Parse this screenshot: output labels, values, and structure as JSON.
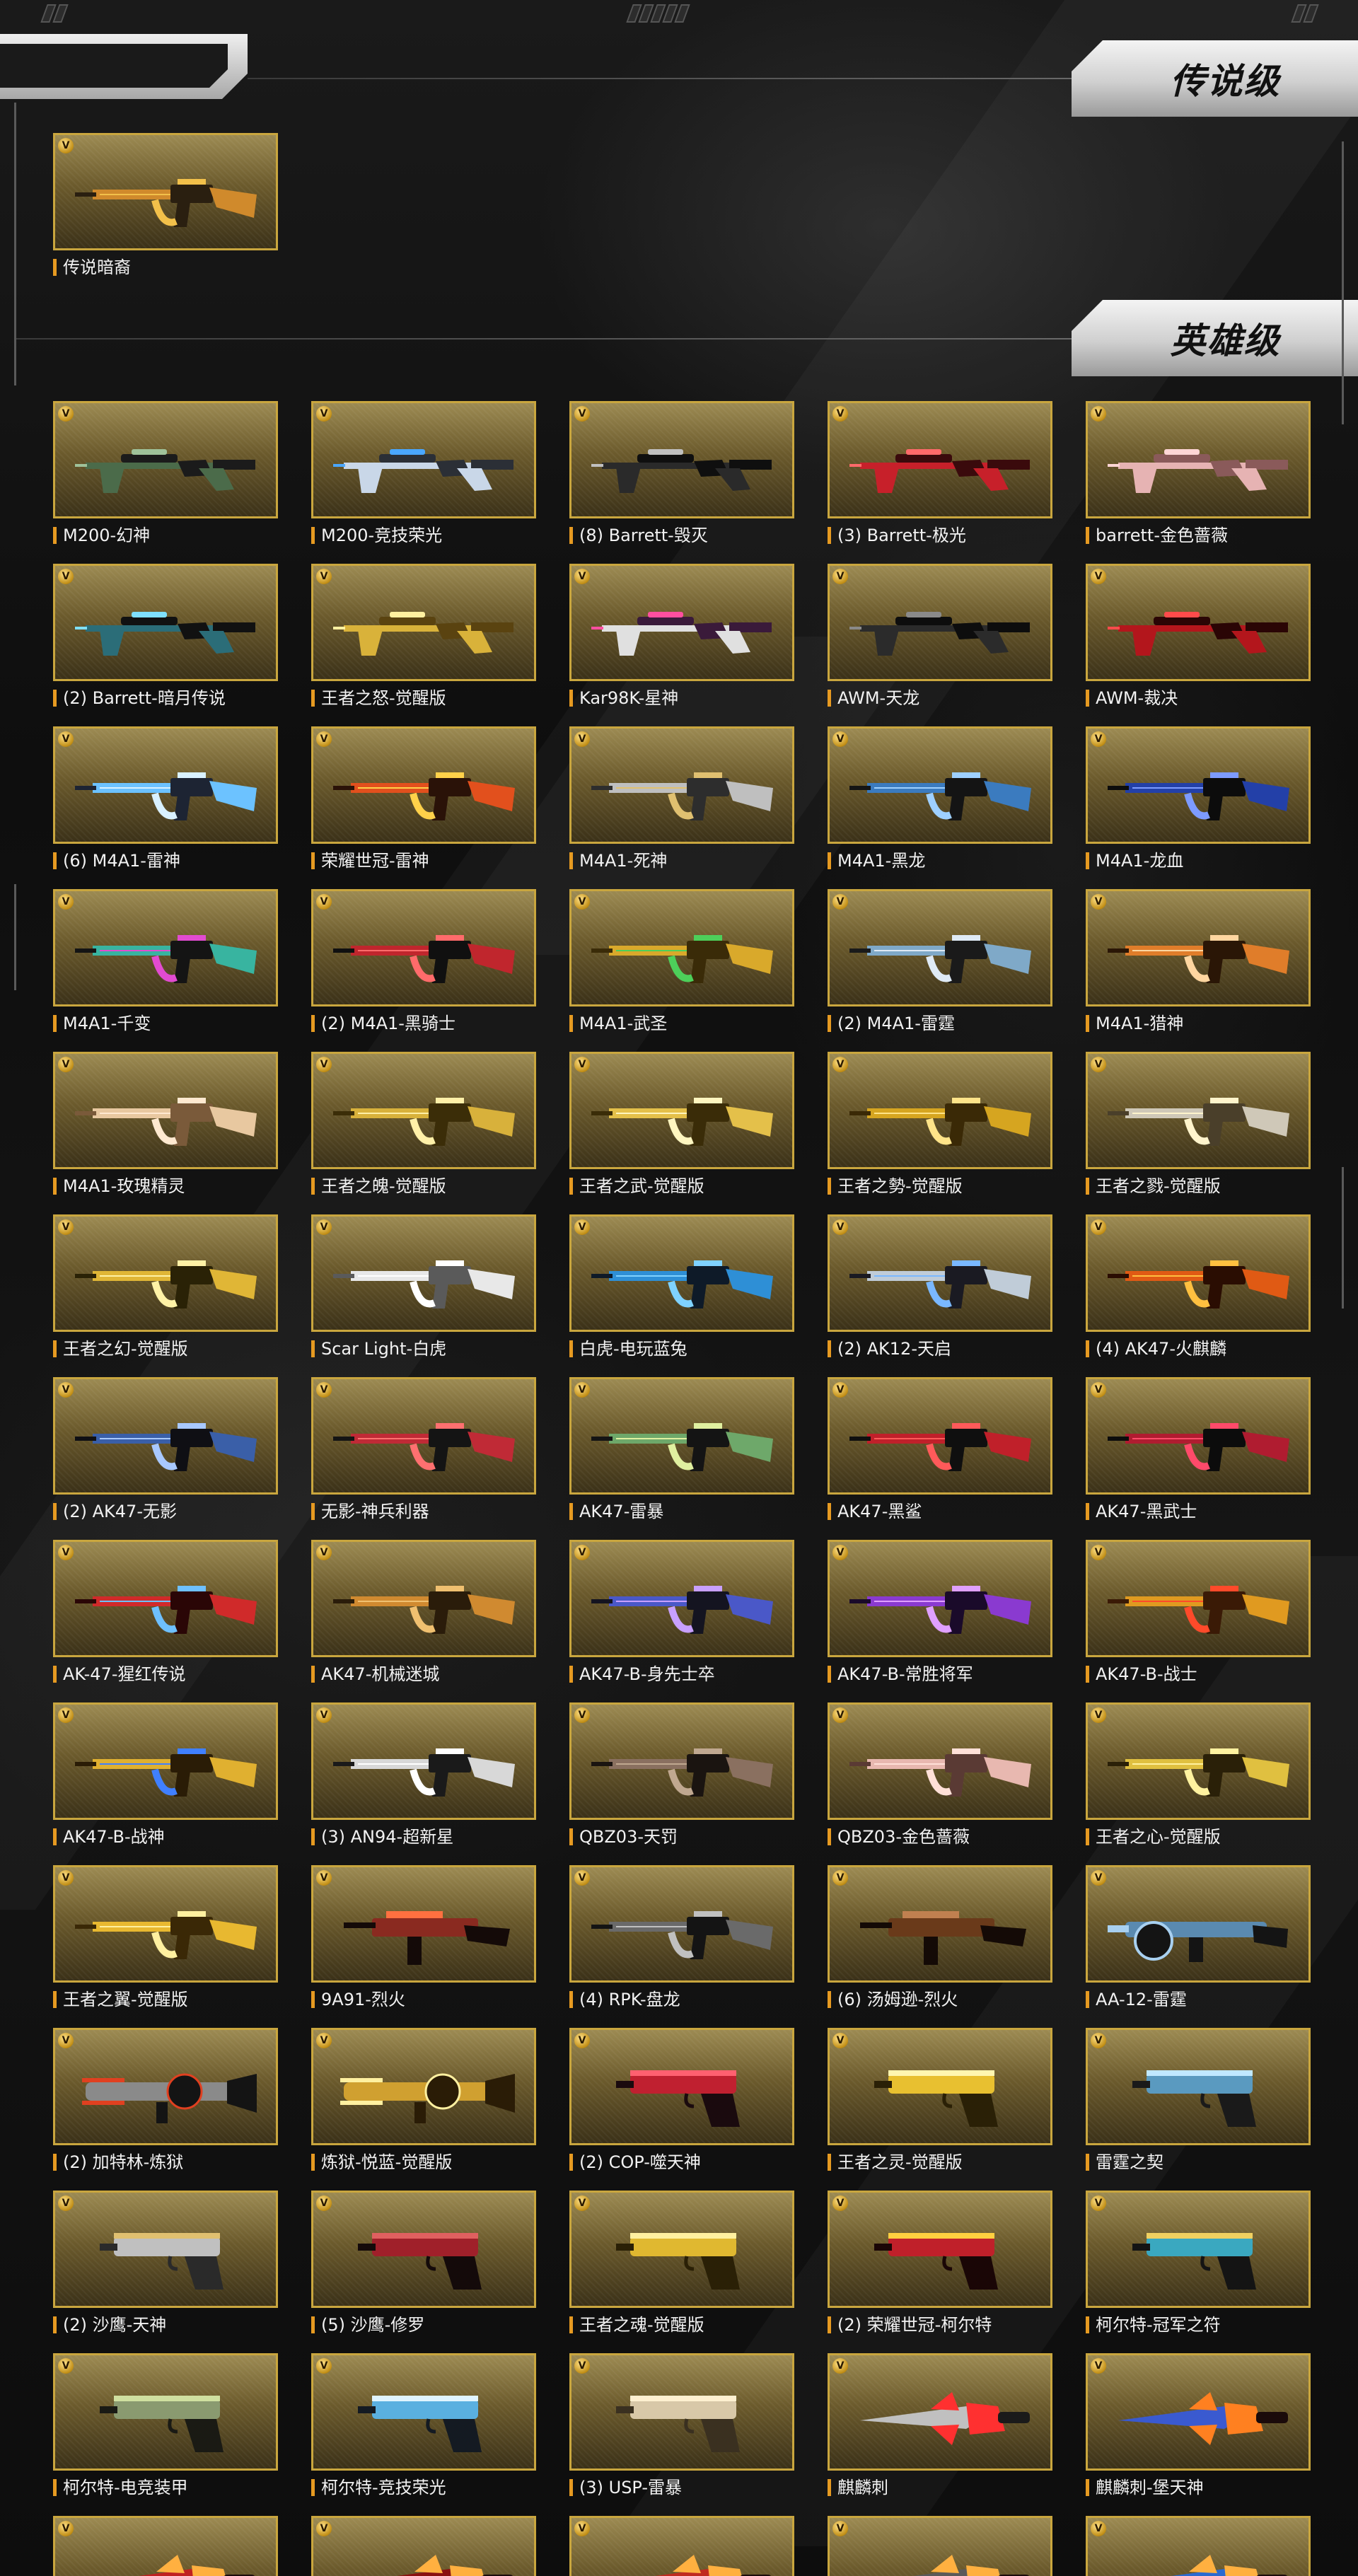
{
  "top_marks": {
    "left": "▯▯",
    "center": "▯▯▯▯▯",
    "right": "▯▯"
  },
  "sections": {
    "legendary": {
      "title": "传说级",
      "items": [
        {
          "name": "传说暗裔",
          "type": "rifle",
          "colors": [
            "#d08a2c",
            "#2a1f10",
            "#f2c04a"
          ]
        }
      ]
    },
    "heroic": {
      "title": "英雄级",
      "items": [
        {
          "name": "M200-幻神",
          "type": "sniper",
          "colors": [
            "#4b6b4a",
            "#1b1b1b",
            "#9fc29a"
          ]
        },
        {
          "name": "M200-竞技荣光",
          "type": "sniper",
          "colors": [
            "#c9d7e8",
            "#2b2f36",
            "#4aa7ff"
          ]
        },
        {
          "name": "(8) Barrett-毁灭",
          "type": "sniper",
          "colors": [
            "#2a2a2a",
            "#0f0f0f",
            "#c0c0c0"
          ]
        },
        {
          "name": "(3) Barrett-极光",
          "type": "sniper",
          "colors": [
            "#c7202a",
            "#3a0a0c",
            "#ff6a6a"
          ]
        },
        {
          "name": "barrett-金色蔷薇",
          "type": "sniper",
          "colors": [
            "#e6b3b3",
            "#8a5a5a",
            "#ffd6d6"
          ]
        },
        {
          "name": "(2) Barrett-暗月传说",
          "type": "sniper",
          "colors": [
            "#2b6d78",
            "#111",
            "#7fe0ff"
          ]
        },
        {
          "name": "王者之怒-觉醒版",
          "type": "sniper",
          "colors": [
            "#d9b23a",
            "#5a4310",
            "#fff0a0"
          ]
        },
        {
          "name": "Kar98K-星神",
          "type": "sniper",
          "colors": [
            "#e0e0e0",
            "#3a1a3a",
            "#ff4fa0"
          ]
        },
        {
          "name": "AWM-天龙",
          "type": "sniper",
          "colors": [
            "#2b2b2b",
            "#0d0d0d",
            "#8a8a8a"
          ]
        },
        {
          "name": "AWM-裁决",
          "type": "sniper",
          "colors": [
            "#b3161c",
            "#2a0505",
            "#ff4b4b"
          ]
        },
        {
          "name": "(6) M4A1-雷神",
          "type": "rifle",
          "colors": [
            "#6cc2ff",
            "#1d2433",
            "#d9f1ff"
          ]
        },
        {
          "name": "荣耀世冠-雷神",
          "type": "rifle",
          "colors": [
            "#e2501d",
            "#2a1208",
            "#ffd14a"
          ]
        },
        {
          "name": "M4A1-死神",
          "type": "rifle",
          "colors": [
            "#bfbfbf",
            "#2d2d2d",
            "#e0c070"
          ]
        },
        {
          "name": "M4A1-黑龙",
          "type": "rifle",
          "colors": [
            "#3b7bbf",
            "#141414",
            "#9ed0ff"
          ]
        },
        {
          "name": "M4A1-龙血",
          "type": "rifle",
          "colors": [
            "#2340a8",
            "#0c0c0c",
            "#7d9bff"
          ]
        },
        {
          "name": "M4A1-千变",
          "type": "rifle",
          "colors": [
            "#38b4a0",
            "#141414",
            "#e24bd1"
          ]
        },
        {
          "name": "(2) M4A1-黑骑士",
          "type": "rifle",
          "colors": [
            "#c0262d",
            "#101010",
            "#ff6b6b"
          ]
        },
        {
          "name": "M4A1-武圣",
          "type": "rifle",
          "colors": [
            "#d9a92b",
            "#3a2b08",
            "#4dcf5a"
          ]
        },
        {
          "name": "(2) M4A1-雷霆",
          "type": "rifle",
          "colors": [
            "#7fa9c8",
            "#1a1a1a",
            "#dfeaf5"
          ]
        },
        {
          "name": "M4A1-猎神",
          "type": "rifle",
          "colors": [
            "#e07d2a",
            "#2a1606",
            "#ffd6a0"
          ]
        },
        {
          "name": "M4A1-玫瑰精灵",
          "type": "rifle",
          "colors": [
            "#e8c8a0",
            "#7a5a3a",
            "#ffe9d0"
          ]
        },
        {
          "name": "王者之魄-觉醒版",
          "type": "rifle",
          "colors": [
            "#d8b13b",
            "#3b2d08",
            "#fff0a8"
          ]
        },
        {
          "name": "王者之武-觉醒版",
          "type": "rifle",
          "colors": [
            "#e4c04a",
            "#3a2c08",
            "#fff6c0"
          ]
        },
        {
          "name": "王者之勢-觉醒版",
          "type": "rifle",
          "colors": [
            "#d6a520",
            "#3a2906",
            "#ffe489"
          ]
        },
        {
          "name": "王者之戮-觉醒版",
          "type": "rifle",
          "colors": [
            "#cfc8b8",
            "#4a3f2a",
            "#fff4cc"
          ]
        },
        {
          "name": "王者之幻-觉醒版",
          "type": "rifle",
          "colors": [
            "#e0b636",
            "#2a2206",
            "#fff2a6"
          ]
        },
        {
          "name": "Scar Light-白虎",
          "type": "rifle",
          "colors": [
            "#e8e8e8",
            "#5a5a5a",
            "#ffffff"
          ]
        },
        {
          "name": "白虎-电玩蓝兔",
          "type": "rifle",
          "colors": [
            "#2e8fd6",
            "#0e1a28",
            "#7fd2ff"
          ]
        },
        {
          "name": "(2) AK12-天启",
          "type": "rifle",
          "colors": [
            "#c0ccd8",
            "#1a1a22",
            "#7ab8ff"
          ]
        },
        {
          "name": "(4) AK47-火麒麟",
          "type": "rifle",
          "colors": [
            "#e05a14",
            "#2a0d02",
            "#ffc040"
          ]
        },
        {
          "name": "(2) AK47-无影",
          "type": "rifle",
          "colors": [
            "#3a5fa8",
            "#0f0f14",
            "#a8c8ff"
          ]
        },
        {
          "name": "无影-神兵利器",
          "type": "rifle",
          "colors": [
            "#c02a36",
            "#141414",
            "#ff7070"
          ]
        },
        {
          "name": "AK47-雷暴",
          "type": "rifle",
          "colors": [
            "#6ea86a",
            "#141414",
            "#e0f0a0"
          ]
        },
        {
          "name": "AK47-黑鲨",
          "type": "rifle",
          "colors": [
            "#c0202a",
            "#0f0f0f",
            "#ff5a5a"
          ]
        },
        {
          "name": "AK47-黑武士",
          "type": "rifle",
          "colors": [
            "#b01c30",
            "#0c0c0c",
            "#ff4a6a"
          ]
        },
        {
          "name": "AK-47-猩红传说",
          "type": "rifle",
          "colors": [
            "#d02a2a",
            "#2a0606",
            "#6ec0ff"
          ]
        },
        {
          "name": "AK47-机械迷城",
          "type": "rifle",
          "colors": [
            "#d08a30",
            "#2a1c0a",
            "#f0c070"
          ]
        },
        {
          "name": "AK47-B-身先士卒",
          "type": "rifle",
          "colors": [
            "#4a58c8",
            "#141420",
            "#c8a0ff"
          ]
        },
        {
          "name": "AK47-B-常胜将军",
          "type": "rifle",
          "colors": [
            "#8a3ad0",
            "#1a0a2a",
            "#e0a0ff"
          ]
        },
        {
          "name": "AK47-B-战士",
          "type": "rifle",
          "colors": [
            "#e09a20",
            "#3a1a06",
            "#ff4a2a"
          ]
        },
        {
          "name": "AK47-B-战神",
          "type": "rifle",
          "colors": [
            "#e0b030",
            "#2a1c06",
            "#4080ff"
          ]
        },
        {
          "name": "(3) AN94-超新星",
          "type": "rifle",
          "colors": [
            "#d8d8d8",
            "#1a1a1a",
            "#ffffff"
          ]
        },
        {
          "name": "QBZ03-天罚",
          "type": "rifle",
          "colors": [
            "#8a7060",
            "#1a1410",
            "#c0a890"
          ]
        },
        {
          "name": "QBZ03-金色蔷薇",
          "type": "rifle",
          "colors": [
            "#e8b8b0",
            "#5a3a34",
            "#ffe0d8"
          ]
        },
        {
          "name": "王者之心-觉醒版",
          "type": "rifle",
          "colors": [
            "#e0c040",
            "#2a2008",
            "#fff2a0"
          ]
        },
        {
          "name": "王者之翼-觉醒版",
          "type": "rifle",
          "colors": [
            "#e8b830",
            "#3a2806",
            "#fff0a0"
          ]
        },
        {
          "name": "9A91-烈火",
          "type": "smg",
          "colors": [
            "#8a2a20",
            "#140a08",
            "#ff7040"
          ]
        },
        {
          "name": "(4) RPK-盘龙",
          "type": "rifle",
          "colors": [
            "#6a6a6a",
            "#141414",
            "#c0c0c0"
          ]
        },
        {
          "name": "(6) 汤姆逊-烈火",
          "type": "smg",
          "colors": [
            "#6a3a1a",
            "#140a06",
            "#c08050"
          ]
        },
        {
          "name": "AA-12-雷霆",
          "type": "shotgun",
          "colors": [
            "#5a8ab0",
            "#141414",
            "#a8d0f0"
          ]
        },
        {
          "name": "(2) 加特林-炼狱",
          "type": "heavy",
          "colors": [
            "#8a8a8a",
            "#141414",
            "#e04020"
          ]
        },
        {
          "name": "炼狱-悦蓝-觉醒版",
          "type": "heavy",
          "colors": [
            "#d0a030",
            "#2a1c06",
            "#fff0a0"
          ]
        },
        {
          "name": "(2) COP-噬天神",
          "type": "pistol",
          "colors": [
            "#c02030",
            "#1a0a0e",
            "#ff6070"
          ]
        },
        {
          "name": "王者之灵-觉醒版",
          "type": "pistol",
          "colors": [
            "#e8c030",
            "#2a2006",
            "#fff6b0"
          ]
        },
        {
          "name": "雷霆之契",
          "type": "pistol",
          "colors": [
            "#5a9ac0",
            "#1a1a1a",
            "#c0e8ff"
          ]
        },
        {
          "name": "(2) 沙鹰-天神",
          "type": "pistol",
          "colors": [
            "#c0c0c0",
            "#2a2a2a",
            "#e0c070"
          ]
        },
        {
          "name": "(5) 沙鹰-修罗",
          "type": "pistol",
          "colors": [
            "#a0202a",
            "#140a0a",
            "#e06060"
          ]
        },
        {
          "name": "王者之魂-觉醒版",
          "type": "pistol",
          "colors": [
            "#e0b830",
            "#2a2006",
            "#fff0a0"
          ]
        },
        {
          "name": "(2) 荣耀世冠-柯尔特",
          "type": "pistol",
          "colors": [
            "#c0202a",
            "#1a0606",
            "#ffd040"
          ]
        },
        {
          "name": "柯尔特-冠军之符",
          "type": "pistol",
          "colors": [
            "#3aa8c0",
            "#141414",
            "#f0d060"
          ]
        },
        {
          "name": "柯尔特-电竞装甲",
          "type": "pistol",
          "colors": [
            "#8a9a70",
            "#1a1a14",
            "#d0e0a0"
          ]
        },
        {
          "name": "柯尔特-竞技荣光",
          "type": "pistol",
          "colors": [
            "#5ab0e0",
            "#141a22",
            "#e0f4ff"
          ]
        },
        {
          "name": "(3) USP-雷暴",
          "type": "pistol",
          "colors": [
            "#d8c8a8",
            "#3a3020",
            "#fff0d0"
          ]
        },
        {
          "name": "麒麟刺",
          "type": "melee",
          "colors": [
            "#c0c0c0",
            "#1a1a1a",
            "#ff3030"
          ]
        },
        {
          "name": "麒麟刺-堡天神",
          "type": "melee",
          "colors": [
            "#3a5ad0",
            "#1a0a0a",
            "#ff8020"
          ]
        }
      ]
    },
    "next_row_partial": [
      "#c02020",
      "#8a1010",
      "#c02a20",
      "#5a5a5a",
      "#2a6ad0"
    ]
  }
}
